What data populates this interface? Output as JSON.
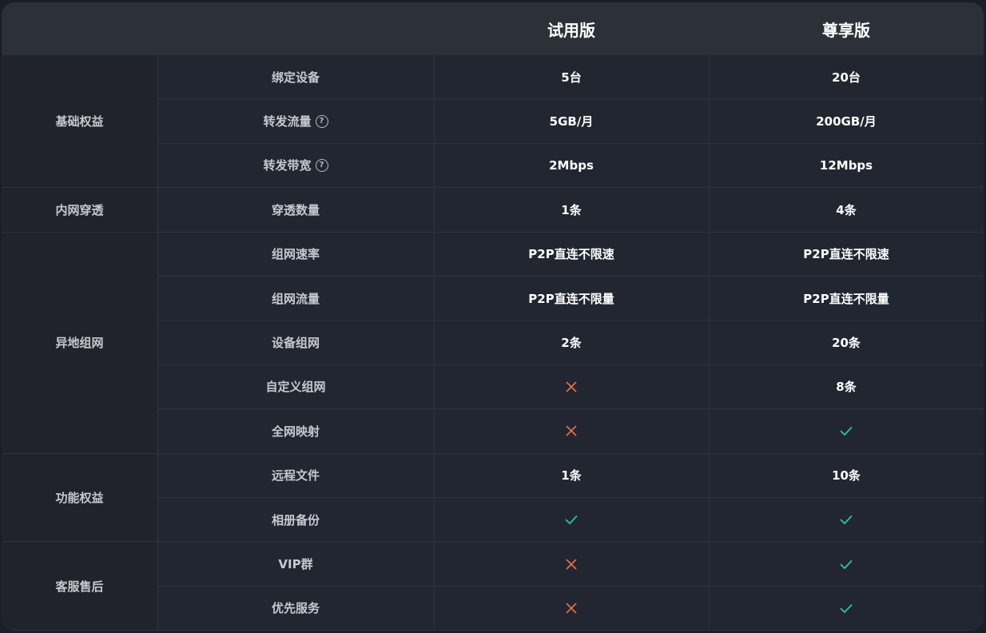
{
  "header": {
    "trial": "试用版",
    "premium": "尊享版"
  },
  "colors": {
    "cross": "#e8704a",
    "check": "#25c99a"
  },
  "categories": [
    {
      "label": "基础权益",
      "rows": 3
    },
    {
      "label": "内网穿透",
      "rows": 1
    },
    {
      "label": "异地组网",
      "rows": 5
    },
    {
      "label": "功能权益",
      "rows": 2
    },
    {
      "label": "客服售后",
      "rows": 2
    }
  ],
  "rows": [
    {
      "feature": "绑定设备",
      "help": false,
      "trial": "5台",
      "premium": "20台"
    },
    {
      "feature": "转发流量",
      "help": true,
      "help_glyph": "?",
      "trial": "5GB/月",
      "premium": "200GB/月"
    },
    {
      "feature": "转发带宽",
      "help": true,
      "help_glyph": "?",
      "trial": "2Mbps",
      "premium": "12Mbps"
    },
    {
      "feature": "穿透数量",
      "help": false,
      "trial": "1条",
      "premium": "4条"
    },
    {
      "feature": "组网速率",
      "help": false,
      "trial": "P2P直连不限速",
      "premium": "P2P直连不限速"
    },
    {
      "feature": "组网流量",
      "help": false,
      "trial": "P2P直连不限量",
      "premium": "P2P直连不限量"
    },
    {
      "feature": "设备组网",
      "help": false,
      "trial": "2条",
      "premium": "20条"
    },
    {
      "feature": "自定义组网",
      "help": false,
      "trial_icon": "cross-icon",
      "premium": "8条"
    },
    {
      "feature": "全网映射",
      "help": false,
      "trial_icon": "cross-icon",
      "premium_icon": "check-icon"
    },
    {
      "feature": "远程文件",
      "help": false,
      "trial": "1条",
      "premium": "10条"
    },
    {
      "feature": "相册备份",
      "help": false,
      "trial_icon": "check-icon",
      "premium_icon": "check-icon"
    },
    {
      "feature": "VIP群",
      "help": false,
      "trial_icon": "cross-icon",
      "premium_icon": "check-icon"
    },
    {
      "feature": "优先服务",
      "help": false,
      "trial_icon": "cross-icon",
      "premium_icon": "check-icon"
    }
  ]
}
